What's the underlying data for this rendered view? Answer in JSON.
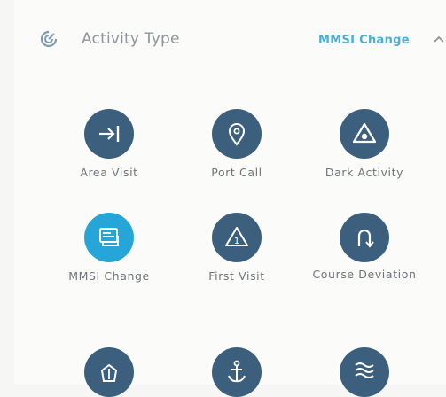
{
  "panel": {
    "title": "Activity Type",
    "selected_value": "MMSI Change",
    "header_icon": "radar-icon",
    "collapse_icon": "chevron-up-icon",
    "accent_color": "#26a6d8",
    "icon_bg_color": "#3d5f7e"
  },
  "tiles": [
    {
      "label": "Area Visit",
      "icon": "enter-arrow-icon",
      "selected": false
    },
    {
      "label": "Port Call",
      "icon": "map-pin-icon",
      "selected": false
    },
    {
      "label": "Dark Activity",
      "icon": "eye-triangle-icon",
      "selected": false
    },
    {
      "label": "MMSI Change",
      "icon": "id-card-icon",
      "selected": true
    },
    {
      "label": "First Visit",
      "icon": "warning-icon",
      "selected": false
    },
    {
      "label": "Course Deviation",
      "icon": "u-turn-icon",
      "selected": false
    },
    {
      "label": "",
      "icon": "ship-icon",
      "selected": false
    },
    {
      "label": "",
      "icon": "anchor-icon",
      "selected": false
    },
    {
      "label": "",
      "icon": "waves-icon",
      "selected": false
    }
  ]
}
